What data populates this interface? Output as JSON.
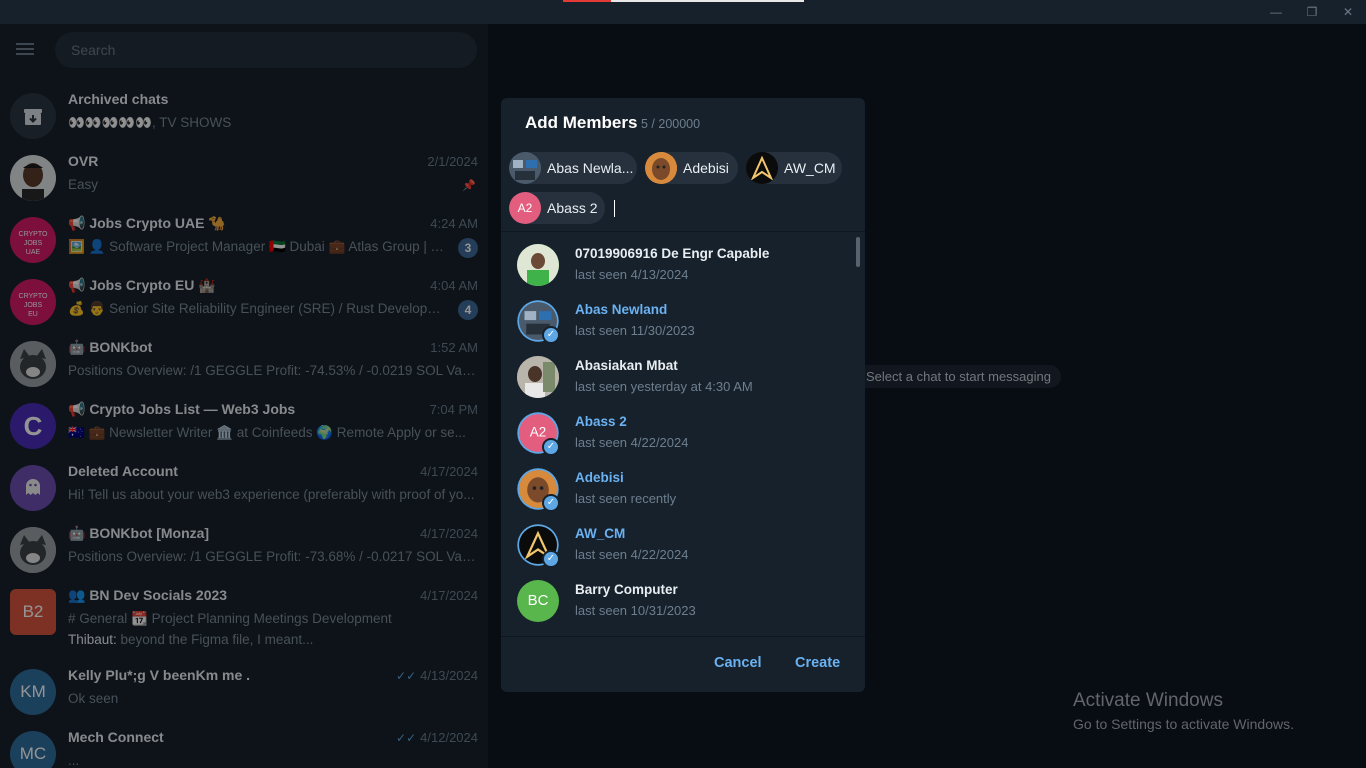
{
  "window": {
    "minimize_icon": "minimize-icon",
    "restore_icon": "restore-icon",
    "close_icon": "close-icon"
  },
  "sidebar": {
    "search_placeholder": "Search",
    "chats": [
      {
        "name": "Archived chats",
        "preview": "👀👀👀👀👀, TV SHOWS",
        "time": "",
        "badge": ""
      },
      {
        "name": "OVR",
        "preview": "Easy",
        "time": "2/1/2024",
        "badge": "",
        "pinned": true
      },
      {
        "name": "📢 Jobs Crypto UAE 🐪",
        "preview": "🖼️ 👤 Software Project Manager 🇦🇪 Dubai 💼 Atlas Group | T...",
        "time": "4:24 AM",
        "badge": "3"
      },
      {
        "name": "📢 Jobs Crypto EU 🏰",
        "preview": "💰 👨 Senior Site Reliability Engineer (SRE) / Rust Developer ...",
        "time": "4:04 AM",
        "badge": "4"
      },
      {
        "name": "🤖 BONKbot",
        "preview": "Positions Overview:  /1 GEGGLE Profit: -74.53% / -0.0219 SOL  Value: ...",
        "time": "1:52 AM",
        "badge": ""
      },
      {
        "name": "📢 Crypto Jobs List — Web3 Jobs",
        "preview": "🇦🇺 💼 Newsletter Writer 🏛️ at Coinfeeds 🌍 Remote Apply or se...",
        "time": "7:04 PM",
        "badge": ""
      },
      {
        "name": "Deleted Account",
        "preview": "Hi! Tell us about your web3 experience (preferably with proof of yo...",
        "time": "4/17/2024",
        "badge": ""
      },
      {
        "name": "🤖 BONKbot [Monza]",
        "preview": "Positions Overview:  /1 GEGGLE Profit: -73.68% / -0.0217 SOL  Value: ...",
        "time": "4/17/2024",
        "badge": ""
      },
      {
        "name": "👥 BN Dev Socials 2023",
        "preview": "# General   📆 Project Planning   Meetings   Development",
        "preview2_sender": "Thibaut:",
        "preview2_text": " beyond the Figma file, I meant...",
        "time": "4/17/2024",
        "badge": ""
      },
      {
        "name": "Kelly Plu*;g V beenKm me .",
        "preview": "Ok seen",
        "time": "4/13/2024",
        "badge": ""
      },
      {
        "name": "Mech Connect",
        "preview": "...",
        "time": "4/12/2024",
        "badge": ""
      }
    ],
    "avatar_initials": {
      "b2": "B2",
      "km": "KM",
      "mc": "MC"
    }
  },
  "main": {
    "start_messaging": "Select a chat to start messaging",
    "activate_title": "Activate Windows",
    "activate_sub": "Go to Settings to activate Windows."
  },
  "modal": {
    "title": "Add Members",
    "count": "5 / 200000",
    "chips": [
      "Abas Newla...",
      "Adebisi",
      "AW_CM",
      "Abass 2"
    ],
    "chip_initials": "A2",
    "members": [
      {
        "name": "07019906916 De Engr Capable",
        "status": "last seen 4/13/2024",
        "selected": false
      },
      {
        "name": "Abas Newland",
        "status": "last seen 11/30/2023",
        "selected": true
      },
      {
        "name": "Abasiakan Mbat",
        "status": "last seen yesterday at 4:30 AM",
        "selected": false
      },
      {
        "name": "Abass 2",
        "status": "last seen 4/22/2024",
        "selected": true,
        "initials": "A2"
      },
      {
        "name": "Adebisi",
        "status": "last seen recently",
        "selected": true
      },
      {
        "name": "AW_CM",
        "status": "last seen 4/22/2024",
        "selected": true
      },
      {
        "name": "Barry Computer",
        "status": "last seen 10/31/2023",
        "selected": false,
        "initials": "BC"
      }
    ],
    "cancel_label": "Cancel",
    "create_label": "Create"
  }
}
